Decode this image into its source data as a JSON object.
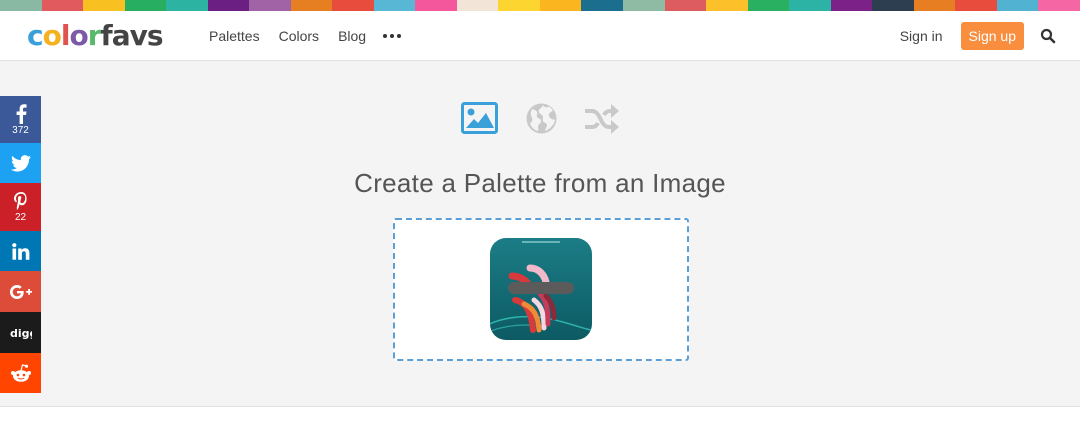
{
  "top_stripe_colors": [
    "#89b9a2",
    "#e15b5e",
    "#f9c021",
    "#27ae60",
    "#2cb3a2",
    "#6c1f82",
    "#a262a6",
    "#e67e22",
    "#e74c3c",
    "#58b7d4",
    "#f4579b",
    "#f2e5d7",
    "#fcd530",
    "#fab51f",
    "#1b6e8e",
    "#8fbaa4",
    "#dc5c5f",
    "#fbc02a",
    "#29b061",
    "#2cb3a5",
    "#7b2187",
    "#2c3e50",
    "#e87e22",
    "#e74c3c",
    "#52b2d2",
    "#f566a4"
  ],
  "header": {
    "logo_text": "colorfavs",
    "logo_letter_colors": [
      "#3aa0d9",
      "#f5b120",
      "#e0544f",
      "#7d5aa6",
      "#58b96a",
      "#444444",
      "#444444",
      "#444444",
      "#444444"
    ],
    "nav_links": [
      "Palettes",
      "Colors",
      "Blog"
    ],
    "signin_label": "Sign in",
    "signup_label": "Sign up",
    "accent_color": "#f98e3e"
  },
  "social": [
    {
      "name": "facebook",
      "icon": "facebook-icon",
      "count": "372",
      "color": "#3b5998"
    },
    {
      "name": "twitter",
      "icon": "twitter-icon",
      "count": "",
      "color": "#1da1f2"
    },
    {
      "name": "pinterest",
      "icon": "pinterest-icon",
      "count": "22",
      "color": "#cb2027"
    },
    {
      "name": "linkedin",
      "icon": "linkedin-icon",
      "count": "",
      "color": "#0077b5"
    },
    {
      "name": "googleplus",
      "icon": "google-plus-icon",
      "count": "",
      "color": "#dd4b39"
    },
    {
      "name": "digg",
      "icon": "digg-icon",
      "count": "",
      "color": "#1b1b1b"
    },
    {
      "name": "reddit",
      "icon": "reddit-icon",
      "count": "",
      "color": "#ff4500"
    }
  ],
  "modes": [
    {
      "name": "image-mode",
      "icon": "image-icon",
      "active": true
    },
    {
      "name": "web-mode",
      "icon": "globe-icon",
      "active": false
    },
    {
      "name": "random-mode",
      "icon": "shuffle-icon",
      "active": false
    }
  ],
  "main": {
    "title": "Create a Palette from an Image",
    "dropzone_border_color": "#5a9fd8"
  }
}
